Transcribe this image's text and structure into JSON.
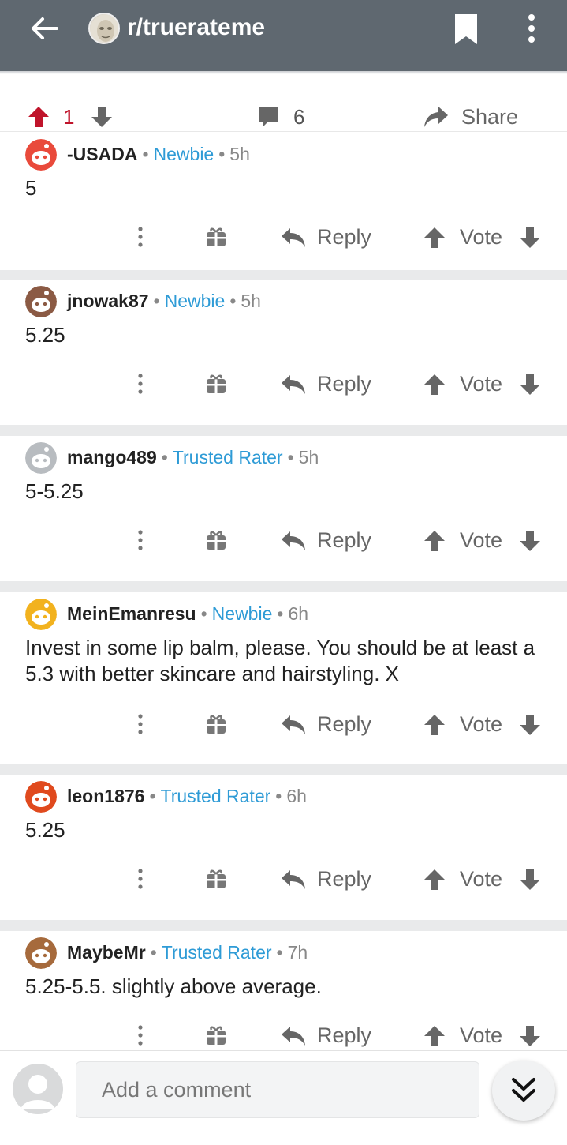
{
  "header": {
    "subreddit": "r/truerateme",
    "back_icon": "arrow-left-icon",
    "bookmark_icon": "bookmark-icon",
    "more_icon": "more-vertical-icon",
    "bg_color": "#5f6870"
  },
  "post_actions": {
    "score": "1",
    "comment_count": "6",
    "share_label": "Share",
    "upvote_color": "#c0142b"
  },
  "comments": [
    {
      "user": "-USADA",
      "flair": "Newbie",
      "age": "5h",
      "body": "5",
      "reply_label": "Reply",
      "vote_label": "Vote"
    },
    {
      "user": "jnowak87",
      "flair": "Newbie",
      "age": "5h",
      "body": "5.25",
      "reply_label": "Reply",
      "vote_label": "Vote"
    },
    {
      "user": "mango489",
      "flair": "Trusted Rater",
      "age": "5h",
      "body": "5-5.25",
      "reply_label": "Reply",
      "vote_label": "Vote"
    },
    {
      "user": "MeinEmanresu",
      "flair": "Newbie",
      "age": "6h",
      "body": "Invest in some lip balm, please. You should be at least a 5.3 with better skincare and hairstyling. X",
      "reply_label": "Reply",
      "vote_label": "Vote"
    },
    {
      "user": "leon1876",
      "flair": "Trusted Rater",
      "age": "6h",
      "body": "5.25",
      "reply_label": "Reply",
      "vote_label": "Vote"
    },
    {
      "user": "MaybeMr",
      "flair": "Trusted Rater",
      "age": "7h",
      "body": "5.25-5.5. slightly above average.",
      "reply_label": "Reply",
      "vote_label": "Vote"
    }
  ],
  "composer": {
    "placeholder": "Add a comment",
    "jump_icon": "double-chevron-down-icon"
  },
  "colors": {
    "flair": "#2e9bd6",
    "divider": "#e9eaeb"
  }
}
